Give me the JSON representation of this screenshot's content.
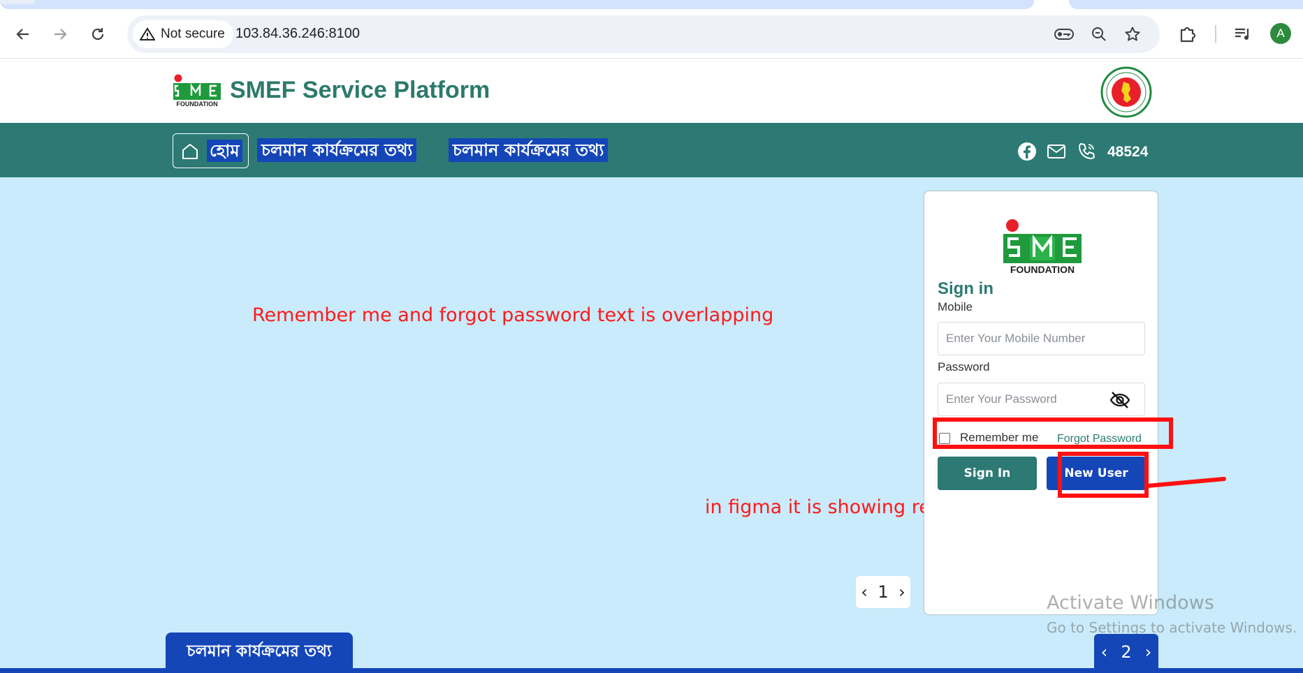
{
  "browser": {
    "security_label": "Not secure",
    "url": "103.84.36.246:8100",
    "avatar_letter": "A"
  },
  "header": {
    "title": "SMEF Service Platform",
    "logo_small_text": "FOUNDATION"
  },
  "nav": {
    "home_label": "হোম",
    "items": [
      "চলমান কার্যক্রমের তথ্য",
      "চলমান কার্যক্রমের তথ্য"
    ],
    "phone_number": "48524"
  },
  "annotations": {
    "overlap_note": "Remember me and forgot password text is overlapping",
    "figma_note": "in figma it is showing register"
  },
  "login": {
    "logo_text": "FOUNDATION",
    "title": "Sign in",
    "mobile_label": "Mobile",
    "mobile_placeholder": "Enter Your Mobile Number",
    "password_label": "Password",
    "password_placeholder": "Enter Your Password",
    "remember_label": "Remember me",
    "forgot_label": "Forgot Password",
    "signin_button": "Sign In",
    "new_user_button": "New User"
  },
  "pager_small": {
    "page": "1"
  },
  "pager_bottom": {
    "page": "2"
  },
  "bottom_tab": {
    "label": "চলমান কার্যক্রমের তথ্য"
  },
  "watermark": {
    "title": "Activate Windows",
    "subtitle": "Go to Settings to activate Windows."
  },
  "colors": {
    "brand_green": "#2c7a73",
    "highlight_blue": "#1446b8",
    "background": "#c9ebfb",
    "annotation_red": "#ff1a1a"
  }
}
